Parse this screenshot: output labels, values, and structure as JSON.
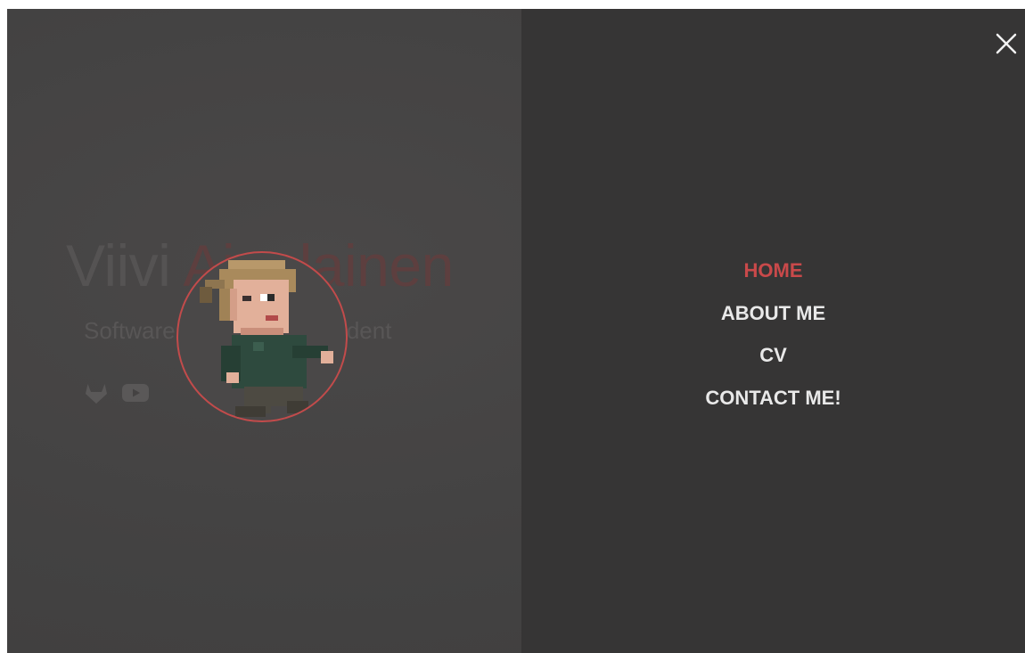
{
  "hero": {
    "name_first": "Viivi",
    "name_last": "Ainalainen",
    "subtitle": "Software Engineering Student",
    "social_icons": [
      "gitlab-icon",
      "youtube-icon"
    ]
  },
  "menu": {
    "close_icon": "close-icon",
    "items": [
      {
        "label": "HOME",
        "active": true
      },
      {
        "label": "ABOUT ME",
        "active": false
      },
      {
        "label": "CV",
        "active": false
      },
      {
        "label": "CONTACT ME!",
        "active": false
      }
    ]
  },
  "colors": {
    "accent": "#c9494a",
    "menu_text": "#e9e9e9",
    "menu_bg": "#363535",
    "page_bg": "#434242"
  }
}
